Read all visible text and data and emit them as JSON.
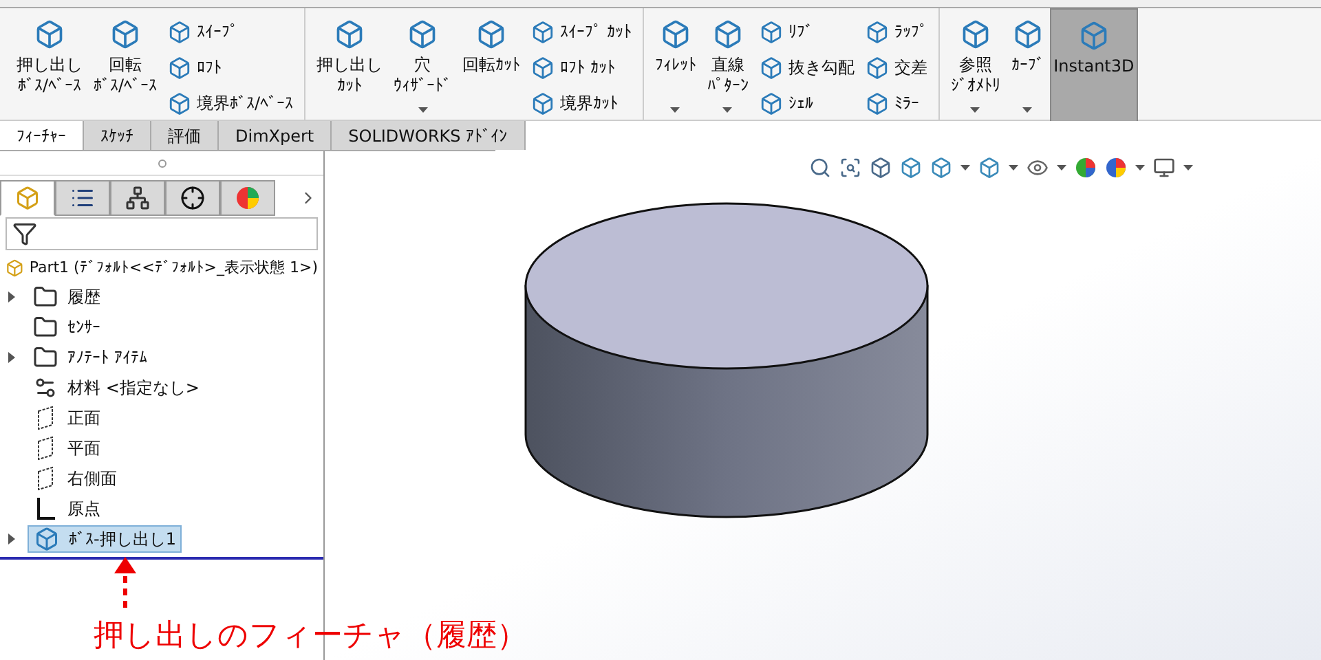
{
  "ribbon": {
    "groups": [
      {
        "items": [
          {
            "kind": "large",
            "lines": [
              "押し出し",
              "ﾎﾞｽ/ﾍﾞｰｽ"
            ],
            "dropdown": false
          },
          {
            "kind": "large",
            "lines": [
              "回転",
              "ﾎﾞｽ/ﾍﾞｰｽ"
            ],
            "dropdown": false
          },
          {
            "kind": "column",
            "items": [
              "ｽｲｰﾌﾟ",
              "ﾛﾌﾄ",
              "境界ﾎﾞｽ/ﾍﾞｰｽ"
            ]
          }
        ]
      },
      {
        "items": [
          {
            "kind": "large",
            "lines": [
              "押し出し",
              "ｶｯﾄ"
            ],
            "dropdown": false
          },
          {
            "kind": "large",
            "lines": [
              "穴",
              "ｳｨｻﾞｰﾄﾞ"
            ],
            "dropdown": true
          },
          {
            "kind": "large",
            "lines": [
              "回転ｶｯﾄ"
            ],
            "dropdown": false
          },
          {
            "kind": "column",
            "items": [
              "ｽｲｰﾌﾟ ｶｯﾄ",
              "ﾛﾌﾄ ｶｯﾄ",
              "境界ｶｯﾄ"
            ]
          }
        ]
      },
      {
        "items": [
          {
            "kind": "large",
            "lines": [
              "ﾌｨﾚｯﾄ"
            ],
            "dropdown": true
          },
          {
            "kind": "large",
            "lines": [
              "直線",
              "ﾊﾟﾀｰﾝ"
            ],
            "dropdown": true
          },
          {
            "kind": "column",
            "items": [
              "ﾘﾌﾞ",
              "抜き勾配",
              "ｼｪﾙ"
            ]
          },
          {
            "kind": "column",
            "items": [
              "ﾗｯﾌﾟ",
              "交差",
              "ﾐﾗｰ"
            ]
          }
        ]
      },
      {
        "items": [
          {
            "kind": "large",
            "lines": [
              "参照",
              "ｼﾞｵﾒﾄﾘ"
            ],
            "dropdown": true
          },
          {
            "kind": "large",
            "lines": [
              "ｶｰﾌﾞ"
            ],
            "dropdown": true
          },
          {
            "kind": "toggle",
            "lines": [
              "Instant3D"
            ],
            "selected": true
          }
        ]
      }
    ]
  },
  "tabs": [
    {
      "label": "ﾌｨｰﾁｬｰ",
      "selected": true
    },
    {
      "label": "ｽｹｯﾁ",
      "selected": false
    },
    {
      "label": "評価",
      "selected": false
    },
    {
      "label": "DimXpert",
      "selected": false
    },
    {
      "label": "SOLIDWORKS ｱﾄﾞｲﾝ",
      "selected": false
    }
  ],
  "panel_tabs": [
    {
      "kind": "tree",
      "selected": true
    },
    {
      "kind": "list",
      "selected": false
    },
    {
      "kind": "config",
      "selected": false
    },
    {
      "kind": "target",
      "selected": false
    },
    {
      "kind": "wheel",
      "selected": false
    }
  ],
  "tree": {
    "label": "Part1 (ﾃﾞﾌｫﾙﾄ<<ﾃﾞﾌｫﾙﾄ>_表示状態 1>)",
    "children": [
      {
        "label": "履歴",
        "kind": "folder",
        "expandable": true,
        "selected": false
      },
      {
        "label": "ｾﾝｻｰ",
        "kind": "folder",
        "expandable": false,
        "selected": false
      },
      {
        "label": "ｱﾉﾃｰﾄ ｱｲﾃﾑ",
        "kind": "folder",
        "expandable": true,
        "selected": false
      },
      {
        "label": "材料 <指定なし>",
        "kind": "material",
        "expandable": false,
        "selected": false
      },
      {
        "label": "正面",
        "kind": "plane",
        "expandable": false,
        "selected": false
      },
      {
        "label": "平面",
        "kind": "plane",
        "expandable": false,
        "selected": false
      },
      {
        "label": "右側面",
        "kind": "plane",
        "expandable": false,
        "selected": false
      },
      {
        "label": "原点",
        "kind": "origin",
        "expandable": false,
        "selected": false
      },
      {
        "label": "ﾎﾞｽ-押し出し1",
        "kind": "feature",
        "expandable": true,
        "selected": true
      }
    ]
  },
  "annotation": {
    "text": "押し出しのフィーチャ（履歴）"
  }
}
